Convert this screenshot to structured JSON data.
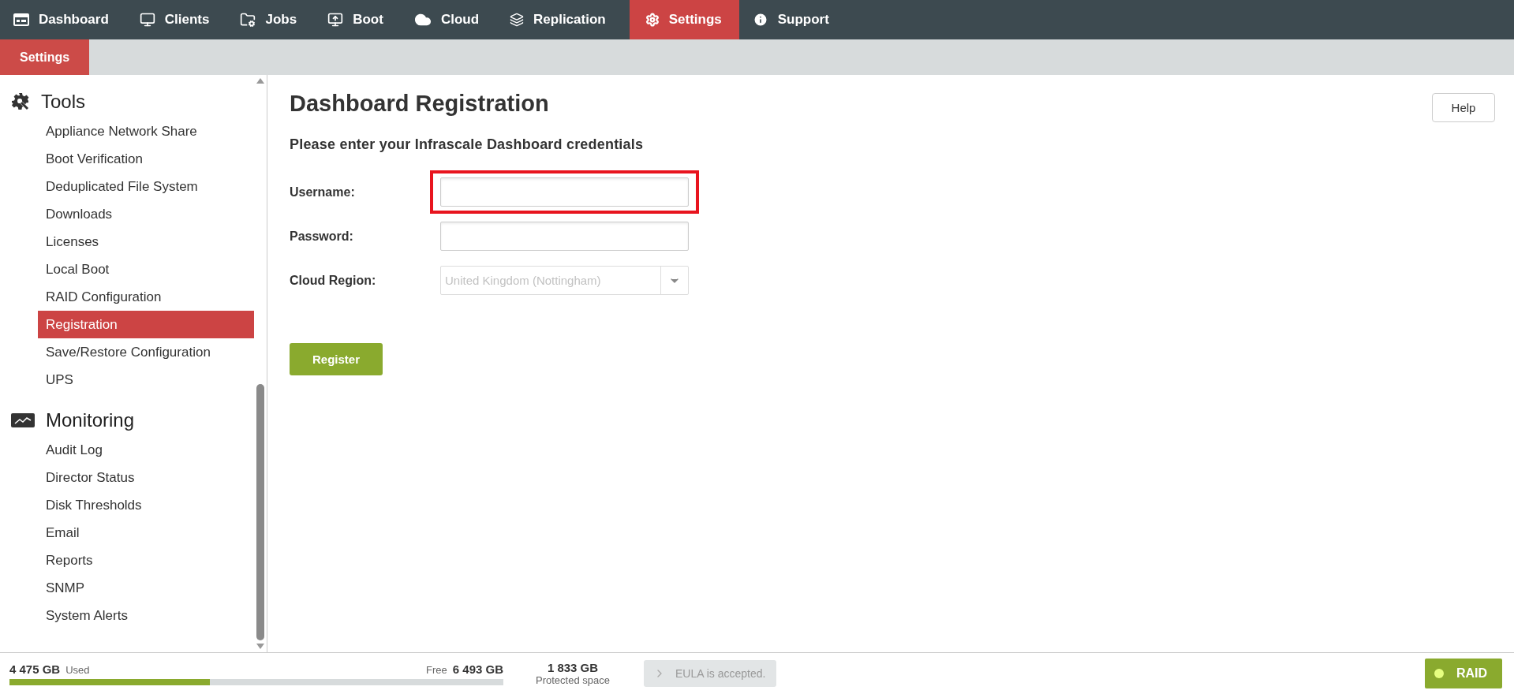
{
  "nav": {
    "items": [
      {
        "label": "Dashboard",
        "selected": false
      },
      {
        "label": "Clients",
        "selected": false
      },
      {
        "label": "Jobs",
        "selected": false
      },
      {
        "label": "Boot",
        "selected": false
      },
      {
        "label": "Cloud",
        "selected": false
      },
      {
        "label": "Replication",
        "selected": false
      },
      {
        "label": "Settings",
        "selected": true
      },
      {
        "label": "Support",
        "selected": false
      }
    ]
  },
  "subnav": {
    "tabs": [
      {
        "label": "Settings",
        "selected": true
      }
    ]
  },
  "sidebar": {
    "sections": [
      {
        "title": "Tools",
        "items": [
          {
            "label": "Appliance Network Share",
            "selected": false
          },
          {
            "label": "Boot Verification",
            "selected": false
          },
          {
            "label": "Deduplicated File System",
            "selected": false
          },
          {
            "label": "Downloads",
            "selected": false
          },
          {
            "label": "Licenses",
            "selected": false
          },
          {
            "label": "Local Boot",
            "selected": false
          },
          {
            "label": "RAID Configuration",
            "selected": false
          },
          {
            "label": "Registration",
            "selected": true
          },
          {
            "label": "Save/Restore Configuration",
            "selected": false
          },
          {
            "label": "UPS",
            "selected": false
          }
        ]
      },
      {
        "title": "Monitoring",
        "items": [
          {
            "label": "Audit Log",
            "selected": false
          },
          {
            "label": "Director Status",
            "selected": false
          },
          {
            "label": "Disk Thresholds",
            "selected": false
          },
          {
            "label": "Email",
            "selected": false
          },
          {
            "label": "Reports",
            "selected": false
          },
          {
            "label": "SNMP",
            "selected": false
          },
          {
            "label": "System Alerts",
            "selected": false
          }
        ]
      }
    ]
  },
  "page": {
    "title": "Dashboard Registration",
    "help_button": "Help",
    "subtitle": "Please enter your Infrascale Dashboard credentials",
    "fields": [
      {
        "label": "Username:",
        "kind": "text",
        "highlighted": true
      },
      {
        "label": "Password:",
        "kind": "password",
        "highlighted": false
      },
      {
        "label": "Cloud Region:",
        "kind": "select",
        "value": "United Kingdom (Nottingham)",
        "disabled": true
      }
    ],
    "submit": "Register"
  },
  "status_bar": {
    "used_value": "4 475 GB",
    "used_label": "Used",
    "free_label": "Free",
    "free_value": "6 493 GB",
    "level": 0.405,
    "protected_value": "1 833 GB",
    "protected_label": "Protected space",
    "eula": "EULA is accepted.",
    "raid": {
      "label": "RAID",
      "color": "#e6ff80"
    }
  }
}
